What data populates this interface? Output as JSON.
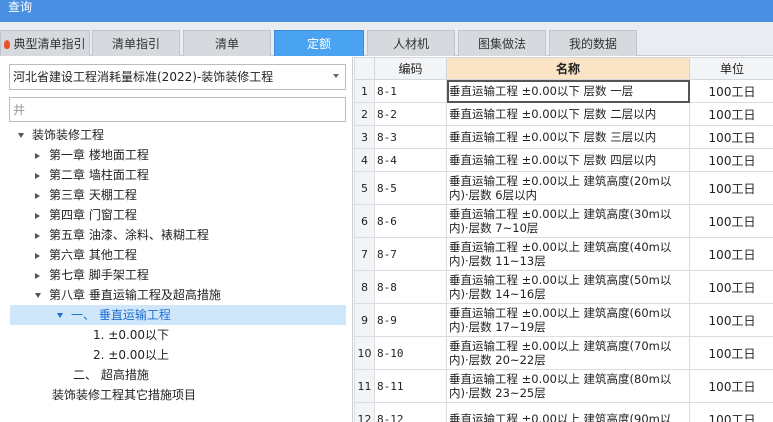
{
  "window": {
    "title": "查询"
  },
  "tabs": [
    {
      "label": "典型清单指引",
      "active": false
    },
    {
      "label": "清单指引",
      "active": false
    },
    {
      "label": "清单",
      "active": false
    },
    {
      "label": "定额",
      "active": true
    },
    {
      "label": "人材机",
      "active": false
    },
    {
      "label": "图集做法",
      "active": false
    },
    {
      "label": "我的数据",
      "active": false
    }
  ],
  "left": {
    "standard_select": "河北省建设工程消耗量标准(2022)-装饰装修工程",
    "search_placeholder": "井",
    "tree": [
      {
        "label": "装饰装修工程"
      },
      {
        "label": "第一章 楼地面工程"
      },
      {
        "label": "第二章 墙柱面工程"
      },
      {
        "label": "第三章 天棚工程"
      },
      {
        "label": "第四章 门窗工程"
      },
      {
        "label": "第五章 油漆、涂料、裱糊工程"
      },
      {
        "label": "第六章 其他工程"
      },
      {
        "label": "第七章 脚手架工程"
      },
      {
        "label": "第八章 垂直运输工程及超高措施"
      },
      {
        "label": "一、 垂直运输工程"
      },
      {
        "label": "1. ±0.00以下"
      },
      {
        "label": "2. ±0.00以上"
      },
      {
        "label": "二、 超高措施"
      },
      {
        "label": "装饰装修工程其它措施项目"
      }
    ]
  },
  "table": {
    "headers": {
      "code": "编码",
      "name": "名称",
      "unit": "单位"
    },
    "rows": [
      {
        "num": "1",
        "code": "8-1",
        "name": "垂直运输工程 ±0.00以下 层数 一层",
        "unit": "100工日"
      },
      {
        "num": "2",
        "code": "8-2",
        "name": "垂直运输工程 ±0.00以下 层数 二层以内",
        "unit": "100工日"
      },
      {
        "num": "3",
        "code": "8-3",
        "name": "垂直运输工程 ±0.00以下 层数 三层以内",
        "unit": "100工日"
      },
      {
        "num": "4",
        "code": "8-4",
        "name": "垂直运输工程 ±0.00以下 层数 四层以内",
        "unit": "100工日"
      },
      {
        "num": "5",
        "code": "8-5",
        "name": "垂直运输工程 ±0.00以上 建筑高度(20m以内)·层数 6层以内",
        "unit": "100工日"
      },
      {
        "num": "6",
        "code": "8-6",
        "name": "垂直运输工程 ±0.00以上 建筑高度(30m以内)·层数 7~10层",
        "unit": "100工日"
      },
      {
        "num": "7",
        "code": "8-7",
        "name": "垂直运输工程 ±0.00以上 建筑高度(40m以内)·层数 11~13层",
        "unit": "100工日"
      },
      {
        "num": "8",
        "code": "8-8",
        "name": "垂直运输工程 ±0.00以上 建筑高度(50m以内)·层数 14~16层",
        "unit": "100工日"
      },
      {
        "num": "9",
        "code": "8-9",
        "name": "垂直运输工程 ±0.00以上 建筑高度(60m以内)·层数 17~19层",
        "unit": "100工日"
      },
      {
        "num": "10",
        "code": "8-10",
        "name": "垂直运输工程 ±0.00以上 建筑高度(70m以内)·层数 20~22层",
        "unit": "100工日"
      },
      {
        "num": "11",
        "code": "8-11",
        "name": "垂直运输工程 ±0.00以上 建筑高度(80m以内)·层数 23~25层",
        "unit": "100工日"
      },
      {
        "num": "12",
        "code": "8-12",
        "name": "垂直运输工程 ±0.00以上 建筑高度(90m以",
        "unit": "100工日"
      }
    ]
  }
}
